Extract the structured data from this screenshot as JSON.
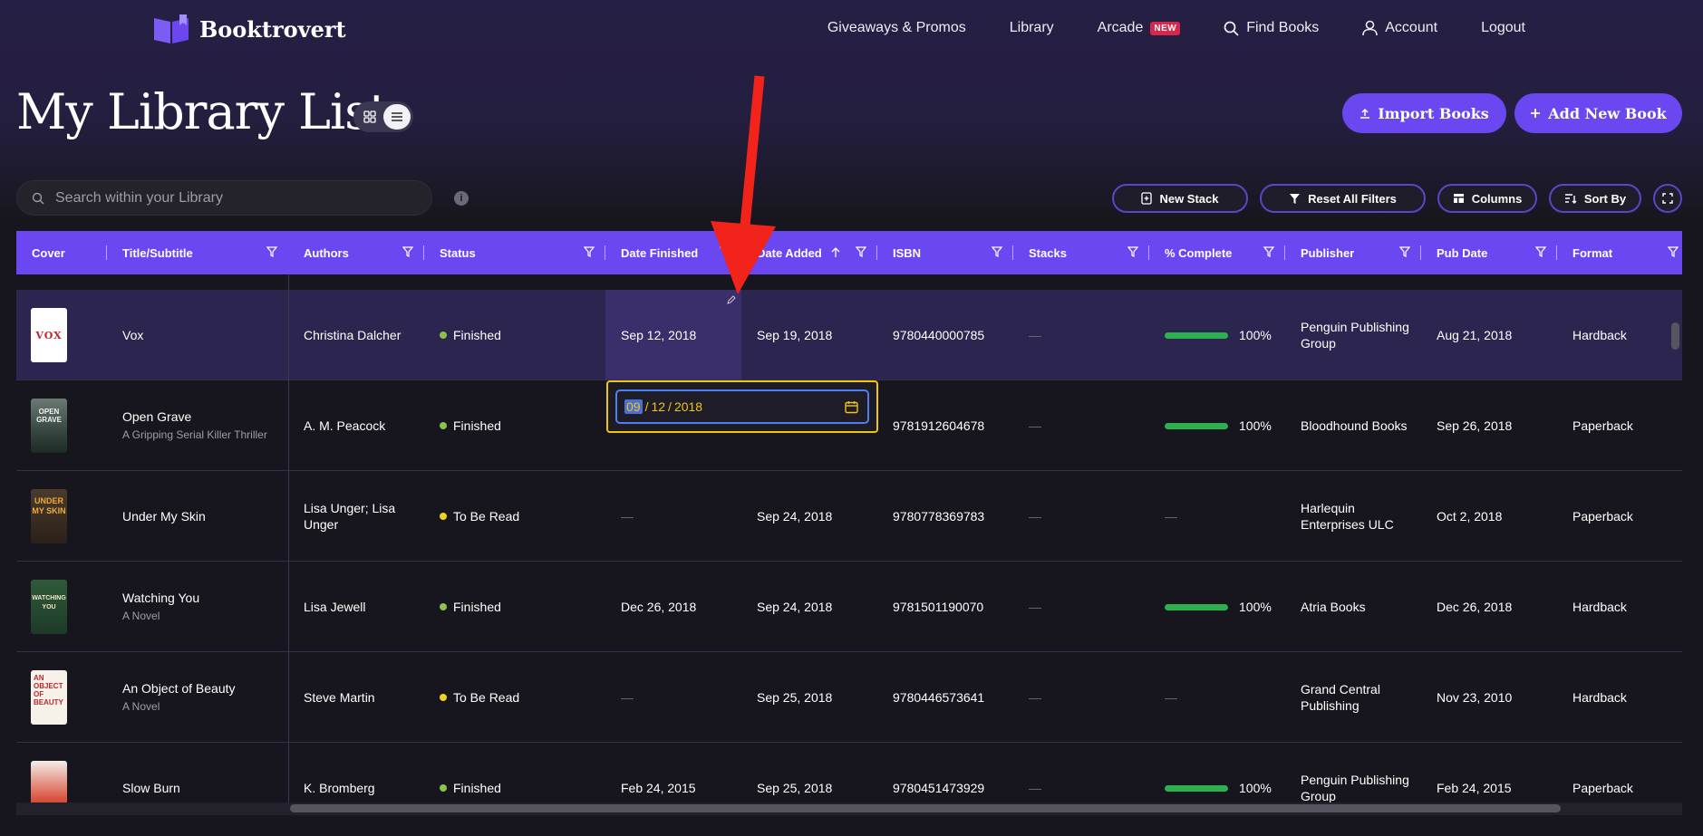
{
  "app": {
    "name": "Booktrovert",
    "brand_color": "#6a47f0"
  },
  "nav": {
    "giveaways": "Giveaways & Promos",
    "library": "Library",
    "arcade": "Arcade",
    "arcade_badge": "NEW",
    "find_books": "Find Books",
    "account": "Account",
    "logout": "Logout"
  },
  "header": {
    "title": "My Library List",
    "import_label": "Import Books",
    "add_label": "Add New Book"
  },
  "toolbar": {
    "search_placeholder": "Search within your Library",
    "info": "i",
    "new_stack": "New Stack",
    "reset_filters": "Reset All Filters",
    "columns": "Columns",
    "sort_by": "Sort By"
  },
  "columns": {
    "cover": "Cover",
    "title": "Title/Subtitle",
    "authors": "Authors",
    "status": "Status",
    "date_finished": "Date Finished",
    "date_added": "Date Added",
    "isbn": "ISBN",
    "stacks": "Stacks",
    "complete": "% Complete",
    "publisher": "Publisher",
    "pub_date": "Pub Date",
    "format": "Format"
  },
  "rows": [
    {
      "title": "Vox",
      "subtitle": "",
      "authors": "Christina Dalcher",
      "status": "Finished",
      "status_color": "#8bc34a",
      "date_finished": "Sep 12, 2018",
      "date_added": "Sep 19, 2018",
      "isbn": "9780440000785",
      "stacks": "—",
      "complete": "100%",
      "complete_value": 100,
      "publisher": "Penguin Publishing Group",
      "pub_date": "Aug 21, 2018",
      "format": "Hardback",
      "cover_text": "VOX"
    },
    {
      "title": "Open Grave",
      "subtitle": "A Gripping Serial Killer Thriller",
      "authors": "A. M. Peacock",
      "status": "Finished",
      "status_color": "#8bc34a",
      "date_finished": "",
      "date_added": "",
      "isbn": "9781912604678",
      "stacks": "—",
      "complete": "100%",
      "complete_value": 100,
      "publisher": "Bloodhound Books",
      "pub_date": "Sep 26, 2018",
      "format": "Paperback",
      "cover_text": "OPEN GRAVE"
    },
    {
      "title": "Under My Skin",
      "subtitle": "",
      "authors": "Lisa Unger; Lisa Unger",
      "status": "To Be Read",
      "status_color": "#f1d21f",
      "date_finished": "—",
      "date_added": "Sep 24, 2018",
      "isbn": "9780778369783",
      "stacks": "—",
      "complete": "—",
      "complete_value": 0,
      "publisher": "Harlequin Enterprises ULC",
      "pub_date": "Oct 2, 2018",
      "format": "Paperback",
      "cover_text": "UNDER MY SKIN"
    },
    {
      "title": "Watching You",
      "subtitle": "A Novel",
      "authors": "Lisa Jewell",
      "status": "Finished",
      "status_color": "#8bc34a",
      "date_finished": "Dec 26, 2018",
      "date_added": "Sep 24, 2018",
      "isbn": "9781501190070",
      "stacks": "—",
      "complete": "100%",
      "complete_value": 100,
      "publisher": "Atria Books",
      "pub_date": "Dec 26, 2018",
      "format": "Hardback",
      "cover_text": "WATCHING YOU"
    },
    {
      "title": "An Object of Beauty",
      "subtitle": "A Novel",
      "authors": "Steve Martin",
      "status": "To Be Read",
      "status_color": "#f1d21f",
      "date_finished": "—",
      "date_added": "Sep 25, 2018",
      "isbn": "9780446573641",
      "stacks": "—",
      "complete": "—",
      "complete_value": 0,
      "publisher": "Grand Central Publishing",
      "pub_date": "Nov 23, 2010",
      "format": "Hardback",
      "cover_text": "AN OBJECT OF BEAUTY"
    },
    {
      "title": "Slow Burn",
      "subtitle": "",
      "authors": "K. Bromberg",
      "status": "Finished",
      "status_color": "#8bc34a",
      "date_finished": "Feb 24, 2015",
      "date_added": "Sep 25, 2018",
      "isbn": "9780451473929",
      "stacks": "—",
      "complete": "100%",
      "complete_value": 100,
      "publisher": "Penguin Publishing Group",
      "pub_date": "Feb 24, 2015",
      "format": "Paperback",
      "cover_text": ""
    }
  ],
  "date_editor": {
    "month": "09",
    "day": "12",
    "year": "2018",
    "sep": "/"
  }
}
